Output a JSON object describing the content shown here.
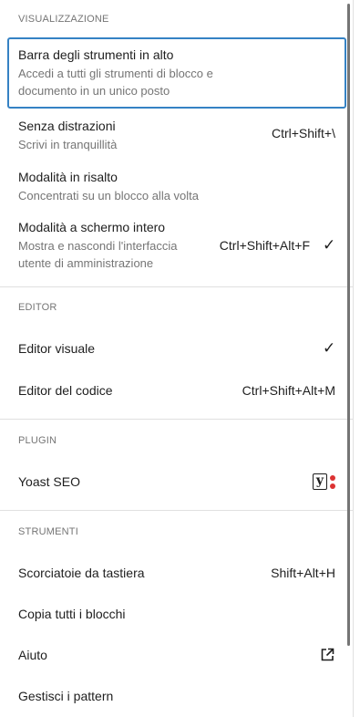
{
  "groups": {
    "view": {
      "title": "VISUALIZZAZIONE",
      "items": [
        {
          "label": "Barra degli strumenti in alto",
          "desc": "Accedi a tutti gli strumenti di blocco e documento in un unico posto",
          "shortcut": ""
        },
        {
          "label": "Senza distrazioni",
          "desc": "Scrivi in tranquillità",
          "shortcut": "Ctrl+Shift+\\"
        },
        {
          "label": "Modalità in risalto",
          "desc": "Concentrati su un blocco alla volta",
          "shortcut": ""
        },
        {
          "label": "Modalità a schermo intero",
          "desc_line1": "Mostra e nascondi l'interfaccia",
          "desc_line2": "utente di amministrazione",
          "shortcut": "Ctrl+Shift+Alt+F",
          "checked": true
        }
      ]
    },
    "editor": {
      "title": "EDITOR",
      "items": [
        {
          "label": "Editor visuale",
          "checked": true
        },
        {
          "label": "Editor del codice",
          "shortcut": "Ctrl+Shift+Alt+M"
        }
      ]
    },
    "plugin": {
      "title": "PLUGIN",
      "items": [
        {
          "label": "Yoast SEO",
          "icon": "yoast-icon",
          "icon_letter": "y"
        }
      ]
    },
    "tools": {
      "title": "STRUMENTI",
      "items": [
        {
          "label": "Scorciatoie da tastiera",
          "shortcut": "Shift+Alt+H"
        },
        {
          "label": "Copia tutti i blocchi"
        },
        {
          "label": "Aiuto",
          "icon": "external-link-icon"
        },
        {
          "label": "Gestisci i pattern"
        }
      ]
    }
  },
  "check_glyph": "✓"
}
